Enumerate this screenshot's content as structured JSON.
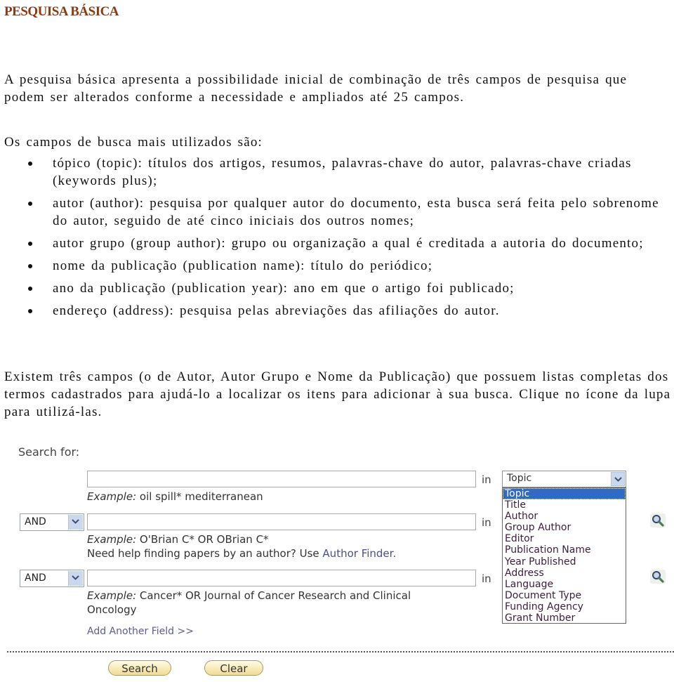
{
  "title": "PESQUISA BÁSICA",
  "intro": "A pesquisa básica apresenta a possibilidade inicial de combinação de três campos de pesquisa que podem ser alterados conforme a necessidade e ampliados até 25 campos.",
  "fields_intro": "Os campos de busca mais utilizados são:",
  "bullets": [
    "tópico (topic): títulos dos artigos, resumos, palavras-chave do autor, palavras-chave criadas (keywords plus);",
    "autor (author): pesquisa por qualquer autor do documento, esta busca será feita pelo sobrenome do autor, seguido de até  cinco iniciais dos outros nomes;",
    "autor grupo (group author): grupo ou organização a qual é creditada a autoria do documento;",
    "nome da publicação (publication name): título do periódico;",
    "ano da publicação (publication year): ano em que o artigo foi publicado;",
    "endereço (address): pesquisa pelas abreviações das afiliações do autor."
  ],
  "lists_paragraph": "Existem três campos (o de Autor, Autor Grupo e Nome da Publicação) que possuem listas completas dos termos cadastrados para ajudá-lo a localizar os itens para adicionar à sua busca. Clique no ícone da lupa para utilizá-las.",
  "form": {
    "search_for_label": "Search for:",
    "in_label": "in",
    "rows": [
      {
        "value": "",
        "example_label": "Example:",
        "example_text": "oil spill* mediterranean",
        "field": "Topic"
      },
      {
        "operator": "AND",
        "value": "",
        "example_label": "Example:",
        "example_text": "O'Brian C* OR OBrian C*",
        "help_text": "Need help finding papers by an author? Use",
        "help_link": "Author Finder."
      },
      {
        "operator": "AND",
        "value": "",
        "example_label": "Example:",
        "example_text": "Cancer* OR Journal of Cancer Research and Clinical",
        "example_text_line2": "Oncology"
      }
    ],
    "field_options": [
      "Topic",
      "Title",
      "Author",
      "Group Author",
      "Editor",
      "Publication Name",
      "Year Published",
      "Address",
      "Language",
      "Document Type",
      "Funding Agency",
      "Grant Number"
    ],
    "selected_field_option": "Topic",
    "add_field_link": "Add Another Field >>",
    "search_button": "Search",
    "clear_button": "Clear",
    "colors": {
      "heading": "#8b3a12",
      "link": "#4a4f8c",
      "selected_option_bg": "#316ac5",
      "button_fill": "#f7e9b0"
    }
  }
}
